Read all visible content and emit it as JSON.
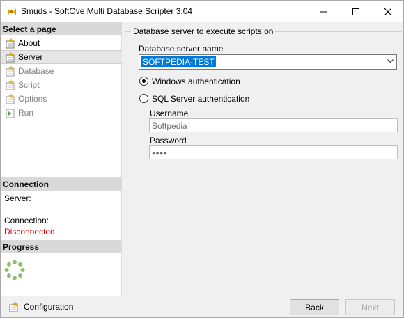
{
  "window": {
    "title": "Smuds - SoftOve Multi Database Scripter 3.04"
  },
  "sidebar": {
    "select_header": "Select a page",
    "items": [
      {
        "label": "About",
        "icon": "sheet-star-icon",
        "state": "normal"
      },
      {
        "label": "Server",
        "icon": "sheet-star-icon",
        "state": "selected"
      },
      {
        "label": "Database",
        "icon": "sheet-star-icon",
        "state": "disabled"
      },
      {
        "label": "Script",
        "icon": "sheet-star-icon",
        "state": "disabled"
      },
      {
        "label": "Options",
        "icon": "sheet-star-icon",
        "state": "disabled"
      },
      {
        "label": "Run",
        "icon": "run-sheet-icon",
        "state": "disabled"
      }
    ],
    "connection_header": "Connection",
    "server_label": "Server:",
    "connection_label": "Connection:",
    "connection_status": "Disconnected",
    "progress_header": "Progress"
  },
  "main": {
    "group_title": "Database server to execute scripts on",
    "server_name_label": "Database server name",
    "server_name_value": "SOFTPEDIA-TEST",
    "auth_windows_label": "Windows authentication",
    "auth_sql_label": "SQL Server authentication",
    "auth_selected": "windows",
    "username_label": "Username",
    "username_value": "Softpedia",
    "password_label": "Password",
    "password_value": "●●●●"
  },
  "footer": {
    "configuration_label": "Configuration",
    "back_label": "Back",
    "next_label": "Next"
  },
  "colors": {
    "selection": "#0078d7",
    "disconnected": "#e00000",
    "progress_ring": "#8fbf6a",
    "header_bg": "#d9d9d9"
  }
}
